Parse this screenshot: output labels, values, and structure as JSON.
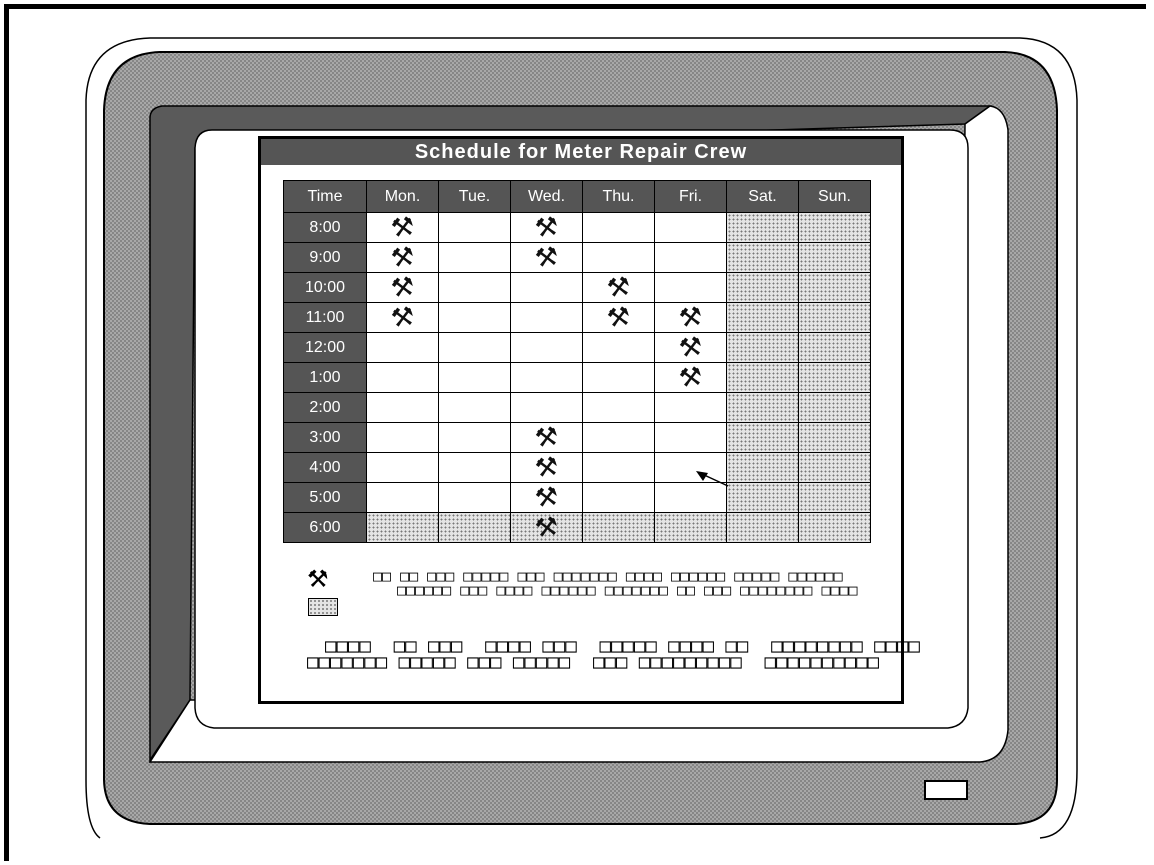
{
  "window": {
    "title": "Schedule for Meter Repair Crew"
  },
  "schedule": {
    "columns": [
      "Time",
      "Mon.",
      "Tue.",
      "Wed.",
      "Thu.",
      "Fri.",
      "Sat.",
      "Sun."
    ],
    "rows": [
      {
        "time": "8:00",
        "marks": [
          1,
          0,
          1,
          0,
          0
        ],
        "blocked_all": false
      },
      {
        "time": "9:00",
        "marks": [
          1,
          0,
          1,
          0,
          0
        ],
        "blocked_all": false
      },
      {
        "time": "10:00",
        "marks": [
          1,
          0,
          0,
          1,
          0
        ],
        "blocked_all": false
      },
      {
        "time": "11:00",
        "marks": [
          1,
          0,
          0,
          1,
          1
        ],
        "blocked_all": false
      },
      {
        "time": "12:00",
        "marks": [
          0,
          0,
          0,
          0,
          1
        ],
        "blocked_all": false
      },
      {
        "time": "1:00",
        "marks": [
          0,
          0,
          0,
          0,
          1
        ],
        "blocked_all": false
      },
      {
        "time": "2:00",
        "marks": [
          0,
          0,
          0,
          0,
          0
        ],
        "blocked_all": false
      },
      {
        "time": "3:00",
        "marks": [
          0,
          0,
          1,
          0,
          0
        ],
        "blocked_all": false
      },
      {
        "time": "4:00",
        "marks": [
          0,
          0,
          1,
          0,
          0
        ],
        "blocked_all": false
      },
      {
        "time": "5:00",
        "marks": [
          0,
          0,
          1,
          0,
          0
        ],
        "blocked_all": false
      },
      {
        "time": "6:00",
        "marks": [
          0,
          0,
          1,
          0,
          0
        ],
        "blocked_all": true
      }
    ],
    "mark_icon": "crossed-pick-icon",
    "blocked_pattern": "dotted-gray"
  },
  "legend": {
    "booked_icon": "crossed-pick-icon",
    "unavailable_icon": "dotted-swatch-icon",
    "booked_text": "□□ □□ □□□ □□□□□ □□□ □□□□□□□ □□□□ □□□□□□ □□□□□ □□□□□□",
    "booked_text_2": "□□□□□□ □□□ □□□□ □□□□□□ □□□□□□□ □□ □□□ □□□□□□□□ □□□□",
    "note_line_1": "□□□□  □□ □□□  □□□□ □□□  □□□□□ □□□□ □□  □□□□□□□□ □□□□",
    "note_line_2": "□□□□□□□ □□□□□ □□□ □□□□□  □□□ □□□□□□□□□  □□□□□□□□□□"
  },
  "colors": {
    "header_bg": "#555555",
    "monitor_bezel": "#8a8a8a",
    "dark_side": "#5a5a5a"
  },
  "cursor": {
    "icon": "arrow-pointer-icon"
  }
}
